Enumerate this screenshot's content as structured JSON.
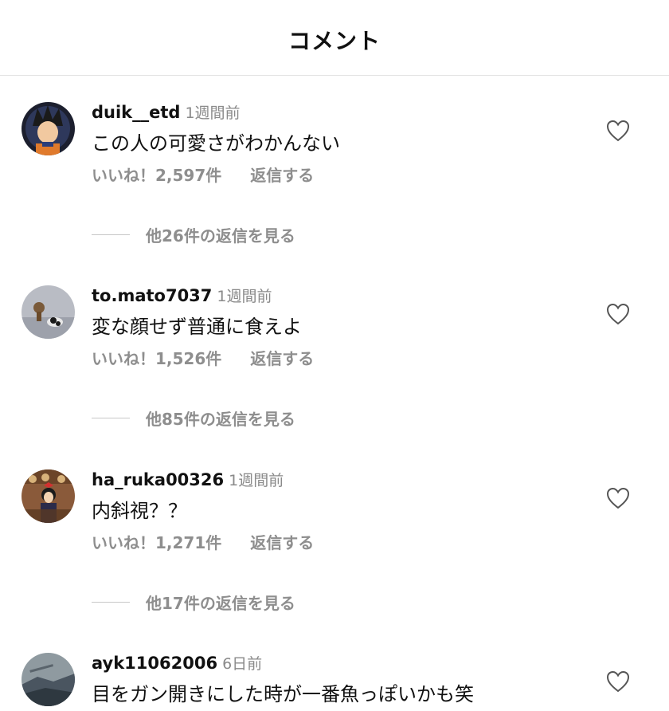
{
  "header": {
    "title": "コメント"
  },
  "comments": [
    {
      "username": "duik__etd",
      "time": "1週間前",
      "text": "この人の可愛さがわかんない",
      "likes": "いいね！2,597件",
      "reply_label": "返信する",
      "view_replies": "他26件の返信を見る",
      "avatar_icon": "anime-character-avatar"
    },
    {
      "username": "to.mato7037",
      "time": "1週間前",
      "text": "変な顔せず普通に食えよ",
      "likes": "いいね！1,526件",
      "reply_label": "返信する",
      "view_replies": "他85件の返信を見る",
      "avatar_icon": "figure-avatar"
    },
    {
      "username": "ha_ruka00326",
      "time": "1週間前",
      "text": "内斜視？？",
      "likes": "いいね！1,271件",
      "reply_label": "返信する",
      "view_replies": "他17件の返信を見る",
      "avatar_icon": "anime-girl-avatar"
    },
    {
      "username": "ayk11062006",
      "time": "6日前",
      "text": "目をガン開きにした時が一番魚っぽいかも笑",
      "avatar_icon": "landscape-avatar"
    }
  ],
  "colors": {
    "text": "#111111",
    "secondary": "#8e8e8e",
    "divider": "#e2e2e2"
  }
}
